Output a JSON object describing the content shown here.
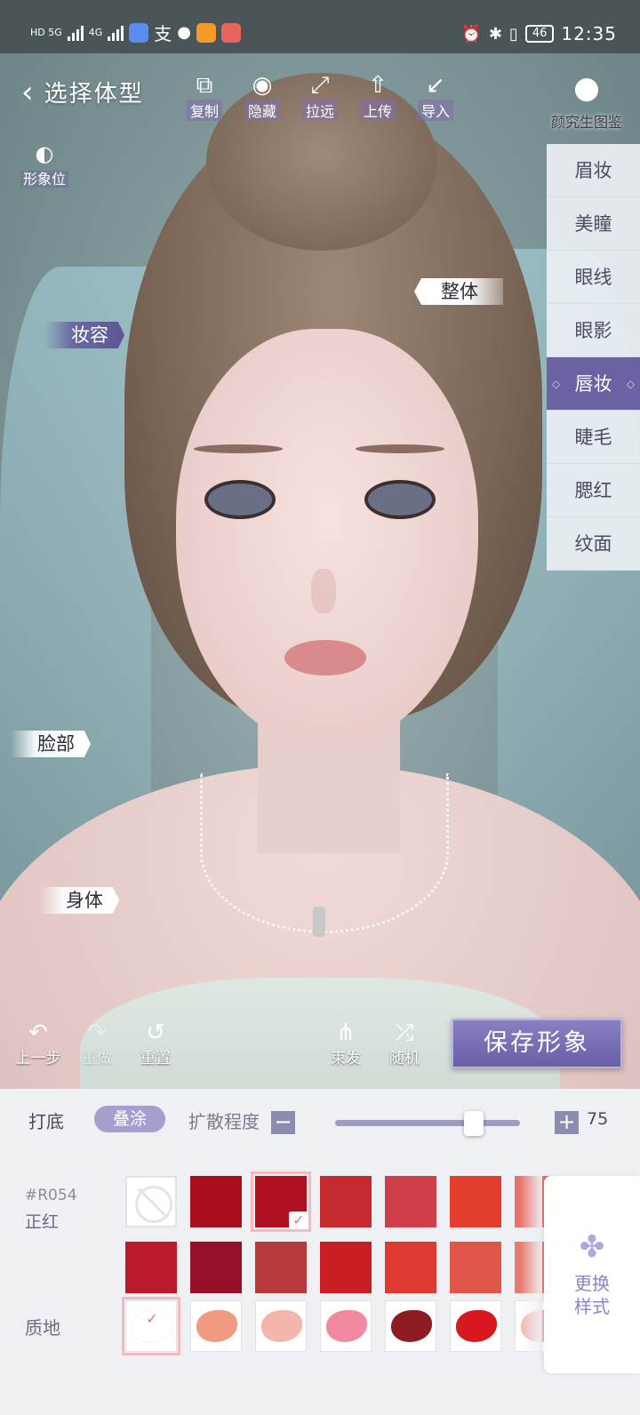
{
  "status_bar": {
    "left_net": "HD 5G",
    "left_net2": "4G",
    "battery": "46",
    "time": "12:35"
  },
  "toolbar": {
    "title": "选择体型",
    "copy": "复制",
    "hide": "隐藏",
    "zoom_out": "拉远",
    "upload": "上传",
    "import": "导入",
    "gallery": "颜究生图鉴",
    "slot": "形象位"
  },
  "side_menu": [
    "眉妆",
    "美瞳",
    "眼线",
    "眼影",
    "唇妆",
    "睫毛",
    "腮红",
    "纹面"
  ],
  "side_menu_active": "唇妆",
  "regions": {
    "makeup": "妆容",
    "whole": "整体",
    "face": "脸部",
    "body": "身体"
  },
  "actions": {
    "undo": "上一步",
    "redo": "重做",
    "reset": "重置",
    "hair_tie": "束发",
    "random": "随机",
    "save": "保存形象"
  },
  "options": {
    "base": "打底",
    "layer": "叠涂",
    "diffusion_label": "扩散程度",
    "minus": "−",
    "plus": "+",
    "value": "75",
    "slider_fraction": 0.75
  },
  "color": {
    "code": "#R054",
    "name": "正红"
  },
  "swatches_row1": [
    "none",
    "#a8101d",
    "#b0101f",
    "#c42a2e",
    "#cf3f4a",
    "#e23d2d",
    "#e8736a"
  ],
  "swatches_row2": [
    "#bb1a2c",
    "#96102c",
    "#b63a3a",
    "#c81e24",
    "#de3a33",
    "#e0574a",
    "#e87b70"
  ],
  "selected_swatch": 2,
  "texture_label": "质地",
  "textures": [
    "#e64a4a",
    "#f09a82",
    "#f4b6ac",
    "#f18aa0",
    "#8d1c22",
    "#d8181e",
    "#f2b7b0"
  ],
  "selected_texture": 0,
  "more_style": "更换样式"
}
